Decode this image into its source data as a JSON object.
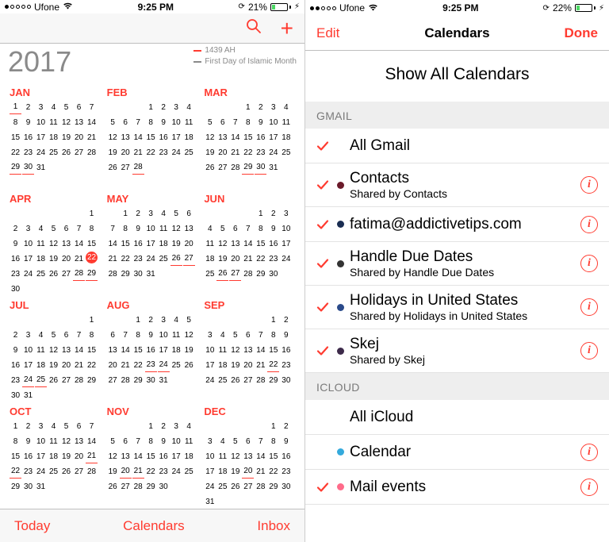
{
  "left": {
    "status": {
      "carrier": "Ufone",
      "time": "9:25 PM",
      "battery": "21%"
    },
    "year": "2017",
    "legend": {
      "a": "1439 AH",
      "b": "First Day of Islamic Month"
    },
    "month_names": [
      "JAN",
      "FEB",
      "MAR",
      "APR",
      "MAY",
      "JUN",
      "JUL",
      "AUG",
      "SEP",
      "OCT",
      "NOV",
      "DEC"
    ],
    "months": [
      {
        "start": 0,
        "days": 31,
        "underline": [
          1,
          29,
          30
        ],
        "today": null
      },
      {
        "start": 3,
        "days": 28,
        "underline": [
          28
        ],
        "today": null
      },
      {
        "start": 3,
        "days": 31,
        "underline": [
          29,
          30
        ],
        "today": null
      },
      {
        "start": 6,
        "days": 30,
        "underline": [
          28,
          29
        ],
        "today": 22
      },
      {
        "start": 1,
        "days": 31,
        "underline": [
          26,
          27
        ],
        "today": null
      },
      {
        "start": 4,
        "days": 30,
        "underline": [
          26,
          27
        ],
        "today": null
      },
      {
        "start": 6,
        "days": 31,
        "underline": [
          24,
          25
        ],
        "today": null
      },
      {
        "start": 2,
        "days": 31,
        "underline": [
          23,
          24
        ],
        "today": null
      },
      {
        "start": 5,
        "days": 30,
        "underline": [
          22
        ],
        "today": null
      },
      {
        "start": 0,
        "days": 31,
        "underline": [
          21,
          22
        ],
        "today": null
      },
      {
        "start": 3,
        "days": 30,
        "underline": [
          20,
          21
        ],
        "today": null
      },
      {
        "start": 5,
        "days": 31,
        "underline": [
          20
        ],
        "today": null
      }
    ],
    "toolbar": {
      "today": "Today",
      "calendars": "Calendars",
      "inbox": "Inbox"
    }
  },
  "right": {
    "status": {
      "carrier": "Ufone",
      "time": "9:25 PM",
      "battery": "22%"
    },
    "header": {
      "edit": "Edit",
      "title": "Calendars",
      "done": "Done"
    },
    "showall": "Show All Calendars",
    "sections": [
      {
        "title": "GMAIL",
        "items": [
          {
            "checked": true,
            "color": null,
            "title": "All Gmail",
            "sub": null,
            "info": false
          },
          {
            "checked": true,
            "color": "#6b1a2a",
            "title": "Contacts",
            "sub": "Shared by Contacts",
            "info": true
          },
          {
            "checked": true,
            "color": "#1a2d52",
            "title": "fatima@addictivetips.com",
            "sub": null,
            "info": true
          },
          {
            "checked": true,
            "color": "#333333",
            "title": "Handle Due Dates",
            "sub": "Shared by Handle Due Dates",
            "info": true
          },
          {
            "checked": true,
            "color": "#2a4a8a",
            "title": "Holidays in United States",
            "sub": "Shared by Holidays in United States",
            "info": true
          },
          {
            "checked": true,
            "color": "#3d2a4a",
            "title": "Skej",
            "sub": "Shared by Skej",
            "info": true
          }
        ]
      },
      {
        "title": "ICLOUD",
        "items": [
          {
            "checked": false,
            "color": null,
            "title": "All iCloud",
            "sub": null,
            "info": false
          },
          {
            "checked": false,
            "color": "#34aadc",
            "title": "Calendar",
            "sub": null,
            "info": true
          },
          {
            "checked": true,
            "color": "#ff6b8a",
            "title": "Mail events",
            "sub": null,
            "info": true
          }
        ]
      }
    ]
  }
}
